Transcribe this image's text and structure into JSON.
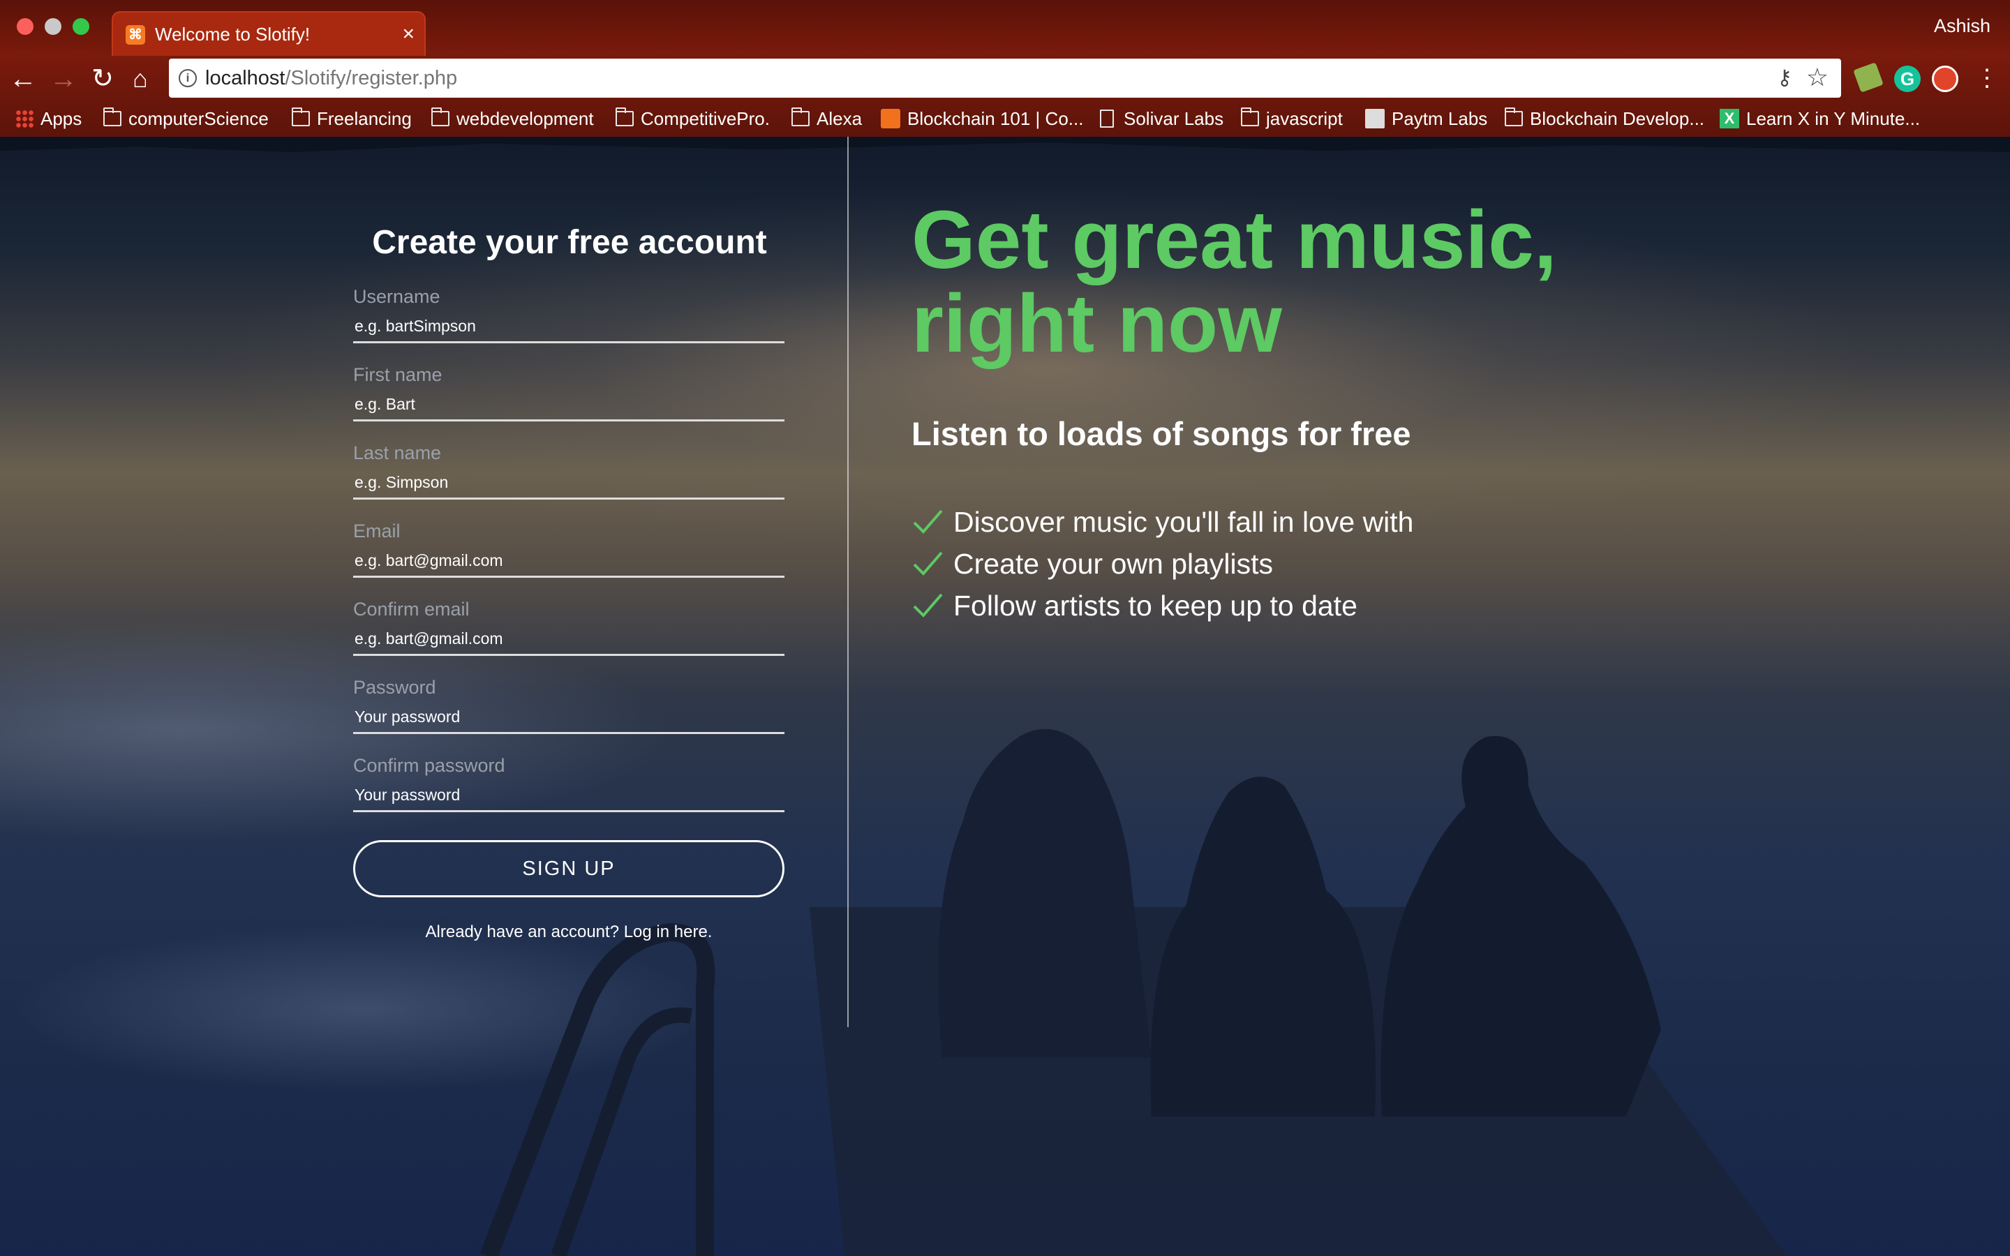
{
  "browser": {
    "tab_title": "Welcome to Slotify!",
    "tab_close": "×",
    "profile_name": "Ashish",
    "url_host": "localhost",
    "url_path": "/Slotify/register.php",
    "bookmarks": [
      "Apps",
      "computerScience",
      "Freelancing",
      "webdevelopment",
      "CompetitivePro.",
      "Alexa",
      "Blockchain 101 | Co...",
      "Solivar Labs",
      "javascript",
      "Paytm Labs",
      "Blockchain Develop...",
      "Learn X in Y Minute..."
    ]
  },
  "register": {
    "title": "Create your free account",
    "fields": [
      {
        "label": "Username",
        "placeholder": "e.g. bartSimpson"
      },
      {
        "label": "First name",
        "placeholder": "e.g. Bart"
      },
      {
        "label": "Last name",
        "placeholder": "e.g. Simpson"
      },
      {
        "label": "Email",
        "placeholder": "e.g. bart@gmail.com"
      },
      {
        "label": "Confirm email",
        "placeholder": "e.g. bart@gmail.com"
      },
      {
        "label": "Password",
        "placeholder": "Your password"
      },
      {
        "label": "Confirm password",
        "placeholder": "Your password"
      }
    ],
    "submit_label": "SIGN UP",
    "login_text": "Already have an account? Log in here."
  },
  "promo": {
    "headline_line1": "Get great music,",
    "headline_line2": "right now",
    "subheading": "Listen to loads of songs for free",
    "features": [
      "Discover music you'll fall in love with",
      "Create your own playlists",
      "Follow artists to keep up to date"
    ]
  },
  "colors": {
    "accent_green": "#5dca63",
    "chrome_red": "#7a1a0c"
  }
}
